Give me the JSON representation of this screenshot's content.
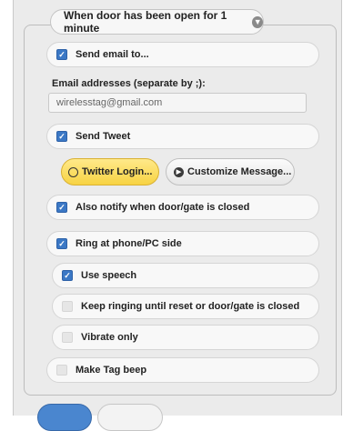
{
  "trigger": {
    "label": "When door has been open for 1 minute"
  },
  "email": {
    "label": "Send email to...",
    "checked": true,
    "addresses_label": "Email addresses (separate by ;):",
    "addresses_value": "wirelesstag@gmail.com"
  },
  "tweet": {
    "label": "Send Tweet",
    "checked": true,
    "login_button": "Twitter Login...",
    "customize_button": "Customize Message..."
  },
  "also_notify": {
    "label": "Also notify when door/gate is closed",
    "checked": true
  },
  "ring": {
    "label": "Ring at phone/PC side",
    "checked": true
  },
  "use_speech": {
    "label": "Use speech",
    "checked": true
  },
  "keep_ringing": {
    "label": "Keep ringing until reset or door/gate is closed",
    "checked": false
  },
  "vibrate": {
    "label": "Vibrate only",
    "checked": false
  },
  "tag_beep": {
    "label": "Make Tag beep",
    "checked": false
  },
  "colors": {
    "accent_blue": "#3b78c5",
    "button_yellow": "#f7d343",
    "panel_bg": "#ebebeb"
  }
}
